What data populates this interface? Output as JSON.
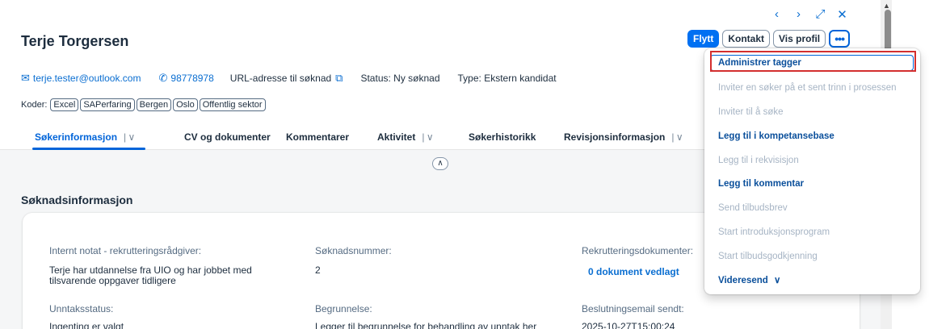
{
  "header": {
    "title": "Terje Torgersen",
    "nav": {
      "prev": "‹",
      "next": "›",
      "expand": "⤢",
      "close": "✕"
    },
    "actions": {
      "move": "Flytt",
      "contact": "Kontakt",
      "view_profile": "Vis profil",
      "more": "•••"
    },
    "email": "terje.tester@outlook.com",
    "phone": "98778978",
    "url_label": "URL-adresse til søknad",
    "status": "Status: Ny søknad",
    "type": "Type: Ekstern kandidat",
    "codes_label": "Koder:",
    "codes": [
      "Excel",
      "SAPerfaring",
      "Bergen",
      "Oslo",
      "Offentlig sektor"
    ]
  },
  "tabs": [
    {
      "label": "Søkerinformasjon",
      "active": true,
      "dropdown": true
    },
    {
      "label": "CV og dokumenter",
      "active": false,
      "dropdown": false
    },
    {
      "label": "Kommentarer",
      "active": false,
      "dropdown": false
    },
    {
      "label": "Aktivitet",
      "active": false,
      "dropdown": true
    },
    {
      "label": "Søkerhistorikk",
      "active": false,
      "dropdown": false
    },
    {
      "label": "Revisjonsinformasjon",
      "active": false,
      "dropdown": true
    }
  ],
  "section": {
    "title": "Søknadsinformasjon",
    "fields": {
      "note_label": "Internt notat - rekrutteringsrådgiver:",
      "note_value_1": "Terje har utdannelse fra UIO og har jobbet med",
      "note_value_2": "tilsvarende oppgaver tidligere",
      "app_no_label": "Søknadsnummer:",
      "app_no_value": "2",
      "docs_label": "Rekrutteringsdokumenter:",
      "docs_value": "0 dokument vedlagt",
      "exception_label": "Unntaksstatus:",
      "exception_value": "Ingenting er valgt",
      "reason_label": "Begrunnelse:",
      "reason_value": "Legger til begrunnelse for behandling av unntak her",
      "email_sent_label": "Beslutningsemail sendt:",
      "email_sent_value": "2025-10-27T15:00:24"
    }
  },
  "menu": {
    "items": [
      {
        "label": "Administrer tagger",
        "enabled": true
      },
      {
        "label": "Inviter en søker på et sent trinn i prosessen",
        "enabled": false
      },
      {
        "label": "Inviter til å søke",
        "enabled": false
      },
      {
        "label": "Legg til i kompetansebase",
        "enabled": true
      },
      {
        "label": "Legg til i rekvisisjon",
        "enabled": false
      },
      {
        "label": "Legg til kommentar",
        "enabled": true
      },
      {
        "label": "Send tilbudsbrev",
        "enabled": false
      },
      {
        "label": "Start introduksjonsprogram",
        "enabled": false
      },
      {
        "label": "Start tilbudsgodkjenning",
        "enabled": false
      },
      {
        "label": "Videresend",
        "enabled": true
      }
    ]
  },
  "colors": {
    "accent": "#0064d9",
    "primary_button": "#0070f2",
    "highlight": "#d32f2f"
  }
}
